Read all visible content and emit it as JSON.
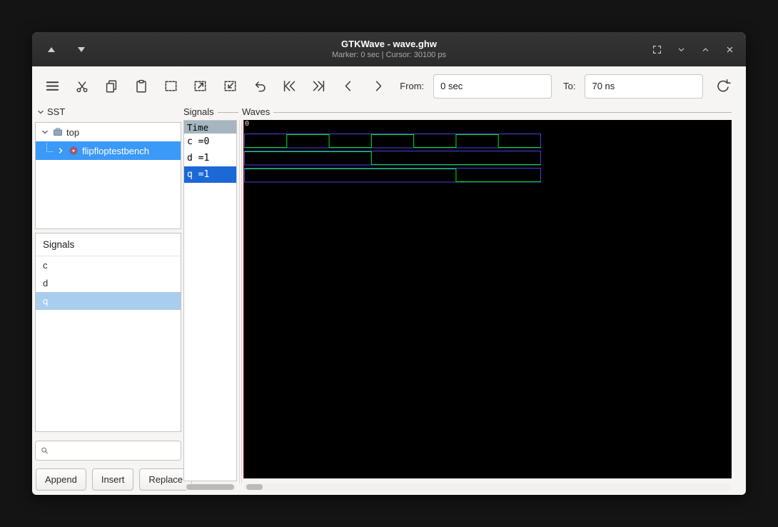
{
  "window": {
    "title": "GTKWave - wave.ghw",
    "subtitle": "Marker: 0 sec | Cursor: 30100 ps"
  },
  "toolbar": {
    "from_label": "From:",
    "from_value": "0 sec",
    "to_label": "To:",
    "to_value": "70 ns",
    "icon_names": [
      "menu-icon",
      "cut-icon",
      "copy-icon",
      "paste-icon",
      "zoom-fit-icon",
      "zoom-in-icon",
      "zoom-out-icon",
      "zoom-undo-icon",
      "zoom-to-start-icon",
      "zoom-to-end-icon",
      "find-previous-edge-icon",
      "find-next-edge-icon",
      "reload-icon"
    ]
  },
  "sst": {
    "header": "SST",
    "items": [
      {
        "label": "top",
        "depth": 0,
        "selected": false,
        "icon": "module-icon"
      },
      {
        "label": "flipfloptestbench",
        "depth": 1,
        "selected": true,
        "icon": "gear-icon"
      }
    ]
  },
  "signal_list": {
    "header": "Signals",
    "items": [
      "c",
      "d",
      "q"
    ],
    "selected_index": 2,
    "buttons": {
      "append": "Append",
      "insert": "Insert",
      "replace": "Replace"
    }
  },
  "name_column": {
    "header": "Signals",
    "time_label": "Time",
    "rows": [
      {
        "label": "c =0",
        "selected": false
      },
      {
        "label": "d =1",
        "selected": false
      },
      {
        "label": "q =1",
        "selected": true
      }
    ]
  },
  "wave_pane": {
    "header": "Waves",
    "origin_label": "0"
  },
  "chart_data": {
    "type": "digital-waveform",
    "title": "Waves",
    "x_unit": "ns",
    "x_range": [
      0,
      70
    ],
    "marker_time_ns": 0,
    "cursor_time_ps": 30100,
    "series": [
      {
        "name": "c",
        "value_at_marker": 0,
        "transitions": [
          [
            0,
            0
          ],
          [
            10,
            1
          ],
          [
            20,
            0
          ],
          [
            30,
            1
          ],
          [
            40,
            0
          ],
          [
            50,
            1
          ],
          [
            60,
            0
          ]
        ]
      },
      {
        "name": "d",
        "value_at_marker": 1,
        "transitions": [
          [
            0,
            1
          ],
          [
            30,
            0
          ]
        ]
      },
      {
        "name": "q",
        "value_at_marker": 1,
        "transitions": [
          [
            0,
            1
          ],
          [
            50,
            0
          ]
        ]
      }
    ],
    "colors": {
      "trace": "#00e61e",
      "frame": "#4545dc",
      "marker": "#a40000",
      "background": "#000000"
    }
  },
  "colors": {
    "tree_selection": "#3b99f7",
    "list_selection_unfocused": "#a9cdec",
    "row_selection": "#1c68d6",
    "time_header_bg": "#a5b6c0"
  }
}
